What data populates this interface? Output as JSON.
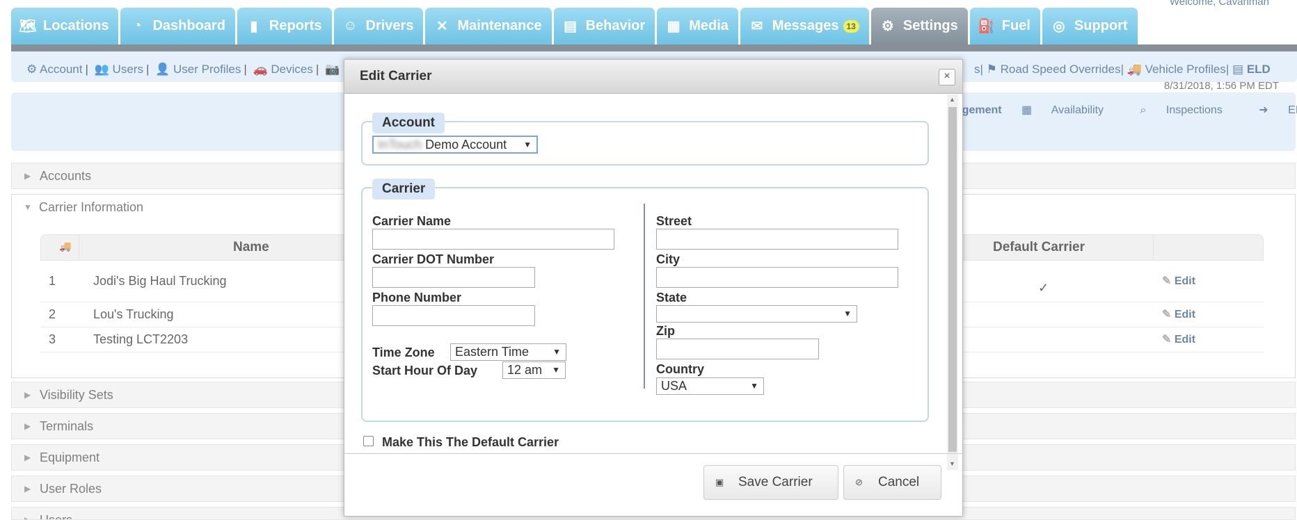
{
  "header": {
    "welcome": "Welcome, Cavanman",
    "tabs": [
      {
        "label": "Locations",
        "icon": "map-icon"
      },
      {
        "label": "Dashboard",
        "icon": "gauge-icon"
      },
      {
        "label": "Reports",
        "icon": "bar-chart-icon"
      },
      {
        "label": "Drivers",
        "icon": "people-icon"
      },
      {
        "label": "Maintenance",
        "icon": "tools-icon"
      },
      {
        "label": "Behavior",
        "icon": "clipboard-icon"
      },
      {
        "label": "Media",
        "icon": "clapper-icon"
      },
      {
        "label": "Messages",
        "icon": "envelope-icon",
        "badge": "13"
      },
      {
        "label": "Settings",
        "icon": "gear-icon",
        "active": true
      },
      {
        "label": "Fuel",
        "icon": "fuel-pump-icon"
      },
      {
        "label": "Support",
        "icon": "lifebuoy-icon"
      }
    ]
  },
  "subnav": {
    "left": [
      "Account",
      "Users",
      "User Profiles",
      "Devices"
    ],
    "right_tail": "s",
    "right": [
      "Road Speed Overrides",
      "Vehicle Profiles",
      "ELD"
    ],
    "timestamp": "8/31/2018, 1:56 PM EDT"
  },
  "eld_links": [
    "nagement",
    "Availability",
    "Inspections",
    "ELD Portal"
  ],
  "accordion": {
    "accounts": "Accounts",
    "carrier_information": "Carrier Information",
    "visibility_sets": "Visibility Sets",
    "terminals": "Terminals",
    "equipment": "Equipment",
    "user_roles": "User Roles",
    "users": "Users"
  },
  "carrier_table": {
    "headers": {
      "name": "Name",
      "default_carrier": "Default Carrier"
    },
    "rows": [
      {
        "num": "1",
        "name": "Jodi's Big Haul Trucking",
        "default_mark": "✓",
        "edit": "Edit"
      },
      {
        "num": "2",
        "name": "Lou's Trucking",
        "default_mark": "",
        "edit": "Edit"
      },
      {
        "num": "3",
        "name": "Testing LCT2203",
        "default_mark": "",
        "edit": "Edit"
      }
    ]
  },
  "modal": {
    "title": "Edit Carrier",
    "close": "×",
    "account_legend": "Account",
    "account_select_blurred": "InTouch",
    "account_select_value": "Demo Account",
    "carrier_legend": "Carrier",
    "fields": {
      "carrier_name": "Carrier Name",
      "dot_number": "Carrier DOT Number",
      "phone": "Phone Number",
      "time_zone": "Time Zone",
      "time_zone_value": "Eastern Time",
      "start_hour": "Start Hour Of Day",
      "start_hour_value": "12 am",
      "street": "Street",
      "city": "City",
      "state": "State",
      "state_value": "",
      "zip": "Zip",
      "country": "Country",
      "country_value": "USA"
    },
    "default_checkbox_label": "Make This The Default Carrier",
    "save_label": "Save Carrier",
    "cancel_label": "Cancel"
  }
}
